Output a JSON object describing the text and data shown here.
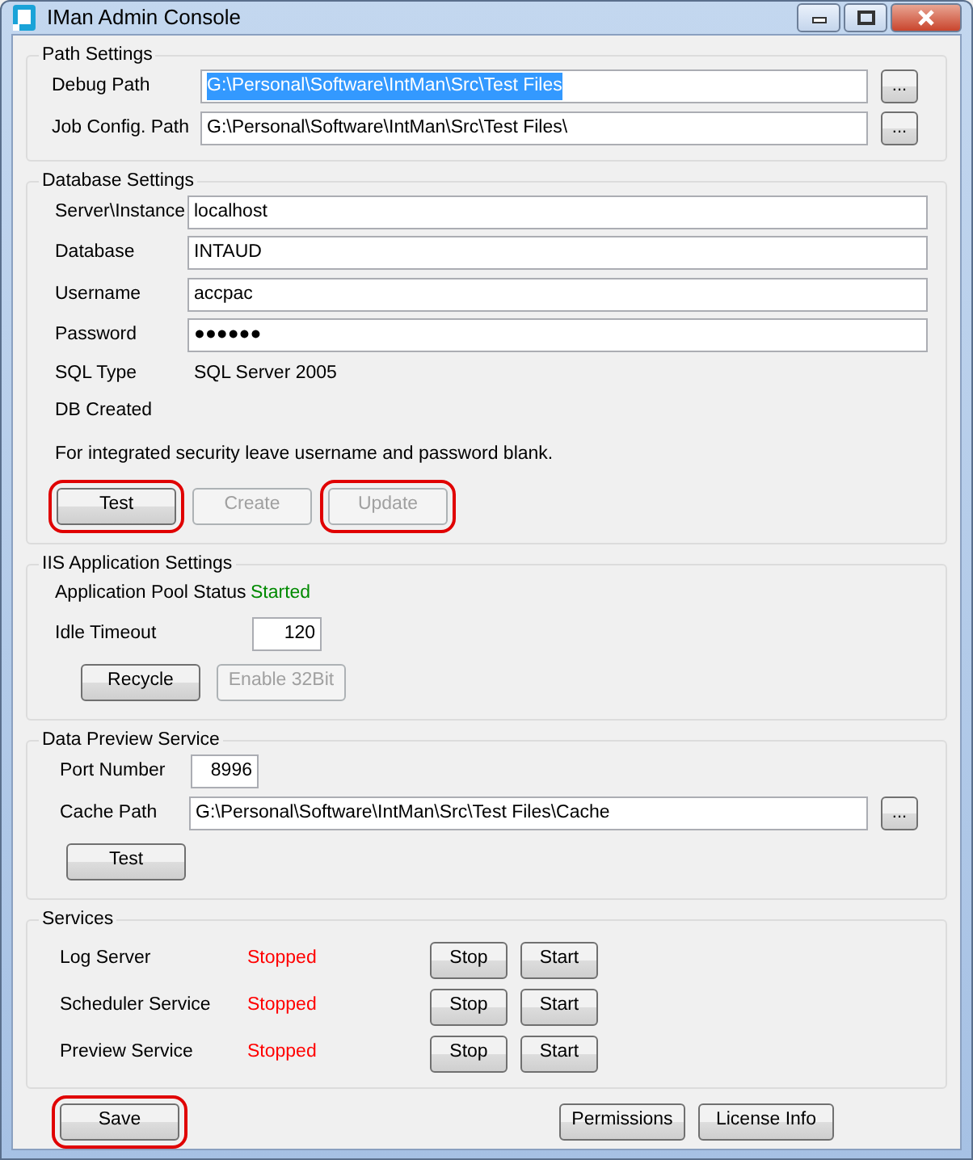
{
  "window": {
    "title": "IMan Admin Console"
  },
  "path_settings": {
    "title": "Path Settings",
    "rows": [
      {
        "label": "Debug Path",
        "value": "G:\\Personal\\Software\\IntMan\\Src\\Test Files",
        "text_selected": true,
        "browse_label": "..."
      },
      {
        "label": "Job Config. Path",
        "value": "G:\\Personal\\Software\\IntMan\\Src\\Test Files\\",
        "text_selected": false,
        "browse_label": "..."
      }
    ]
  },
  "database_settings": {
    "title": "Database Settings",
    "fields": [
      {
        "label": "Server\\Instance",
        "value": "localhost"
      },
      {
        "label": "Database",
        "value": "INTAUD"
      },
      {
        "label": "Username",
        "value": "accpac"
      },
      {
        "label": "Password",
        "value": "●●●●●●"
      }
    ],
    "info": [
      {
        "label": "SQL Type",
        "value": "SQL Server 2005"
      },
      {
        "label": "DB Created"
      }
    ],
    "note": "For integrated security leave username and password blank.",
    "buttons": [
      {
        "label": "Test",
        "disabled": false,
        "highlighted": true
      },
      {
        "label": "Create",
        "disabled": true,
        "highlighted": false
      },
      {
        "label": "Update",
        "disabled": true,
        "highlighted": true
      }
    ]
  },
  "iis_settings": {
    "title": "IIS Application Settings",
    "status": {
      "label": "Application Pool Status",
      "value": "Started",
      "color": "#008a00"
    },
    "idle_timeout": {
      "label": "Idle Timeout",
      "value": "120"
    },
    "buttons": [
      {
        "label": "Recycle",
        "disabled": false,
        "highlighted": false
      },
      {
        "label": "Enable 32Bit",
        "disabled": true,
        "highlighted": false
      }
    ]
  },
  "data_preview": {
    "title": "Data Preview Service",
    "port": {
      "label": "Port Number",
      "value": "8996"
    },
    "cache_path": {
      "label": "Cache Path",
      "value": "G:\\Personal\\Software\\IntMan\\Src\\Test Files\\Cache",
      "browse_label": "..."
    },
    "buttons": [
      {
        "label": "Test",
        "disabled": false,
        "highlighted": false
      }
    ]
  },
  "services": {
    "title": "Services",
    "rows": [
      {
        "name": "Log Server",
        "status": "Stopped",
        "color": "#ff0000",
        "buttons": [
          {
            "label": "Stop",
            "disabled": false,
            "highlighted": false
          },
          {
            "label": "Start",
            "disabled": false,
            "highlighted": false
          }
        ]
      },
      {
        "name": "Scheduler Service",
        "status": "Stopped",
        "color": "#ff0000",
        "buttons": [
          {
            "label": "Stop",
            "disabled": false,
            "highlighted": false
          },
          {
            "label": "Start",
            "disabled": false,
            "highlighted": false
          }
        ]
      },
      {
        "name": "Preview Service",
        "status": "Stopped",
        "color": "#ff0000",
        "buttons": [
          {
            "label": "Stop",
            "disabled": false,
            "highlighted": false
          },
          {
            "label": "Start",
            "disabled": false,
            "highlighted": false
          }
        ]
      }
    ]
  },
  "footer": {
    "left_buttons": [
      {
        "label": "Save",
        "disabled": false,
        "highlighted": true
      }
    ],
    "right_buttons": [
      {
        "label": "Permissions",
        "disabled": false,
        "highlighted": false
      },
      {
        "label": "License Info",
        "disabled": false,
        "highlighted": false
      }
    ]
  }
}
